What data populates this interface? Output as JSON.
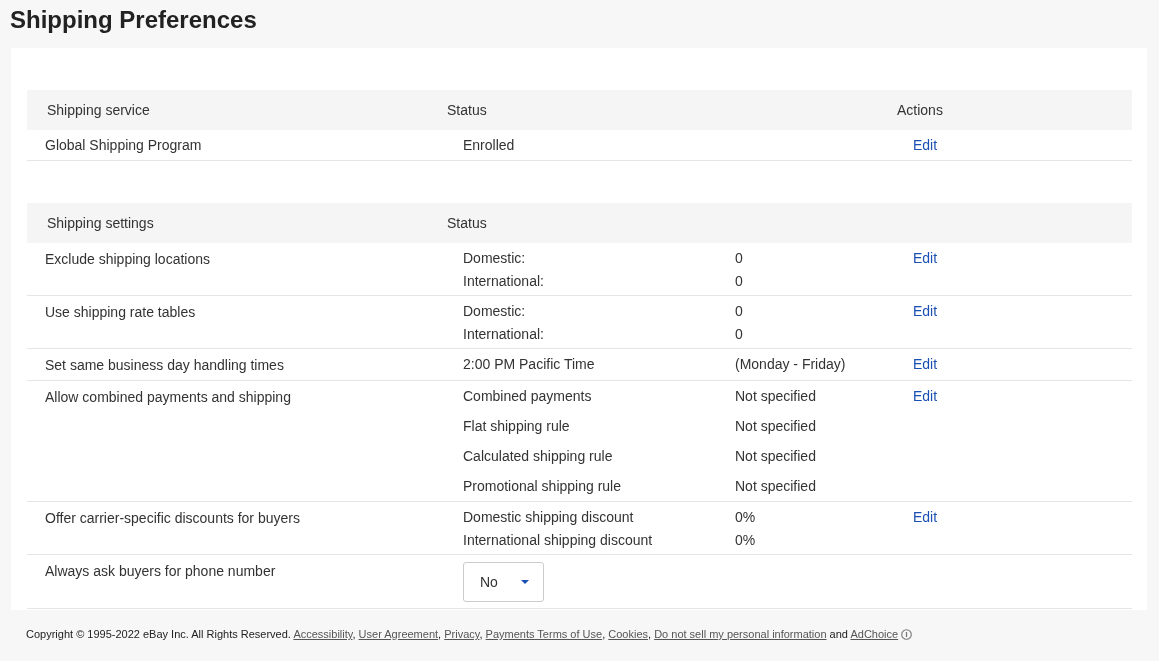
{
  "title": "Shipping Preferences",
  "service_table": {
    "columns": [
      "Shipping service",
      "Status",
      "Actions"
    ],
    "rows": [
      {
        "service": "Global Shipping Program",
        "status": "Enrolled",
        "action": "Edit"
      }
    ]
  },
  "settings_table": {
    "columns": [
      "Shipping settings",
      "Status"
    ],
    "rows": [
      {
        "kind": "pairs",
        "setting": "Exclude shipping locations",
        "details": [
          {
            "label": "Domestic:",
            "value": "0"
          },
          {
            "label": "International:",
            "value": "0"
          }
        ],
        "action": "Edit"
      },
      {
        "kind": "pairs",
        "setting": "Use shipping rate tables",
        "details": [
          {
            "label": "Domestic:",
            "value": "0"
          },
          {
            "label": "International:",
            "value": "0"
          }
        ],
        "action": "Edit"
      },
      {
        "kind": "pairs",
        "setting": "Set same business day handling times",
        "details": [
          {
            "label": "2:00 PM Pacific Time",
            "value": "(Monday - Friday)"
          }
        ],
        "action": "Edit"
      },
      {
        "kind": "list",
        "setting": "Allow combined payments and shipping",
        "details": [
          {
            "label": "Combined payments",
            "value": "Not specified"
          },
          {
            "label": "Flat shipping rule",
            "value": "Not specified"
          },
          {
            "label": "Calculated shipping rule",
            "value": "Not specified"
          },
          {
            "label": "Promotional shipping rule",
            "value": "Not specified"
          }
        ],
        "action": "Edit"
      },
      {
        "kind": "pairs",
        "setting": "Offer carrier-specific discounts for buyers",
        "details": [
          {
            "label": "Domestic shipping discount",
            "value": "0%"
          },
          {
            "label": "International shipping discount",
            "value": "0%"
          }
        ],
        "action": "Edit"
      },
      {
        "kind": "dropdown",
        "setting": "Always ask buyers for phone number",
        "value": "No"
      }
    ]
  },
  "footer": [
    {
      "kind": "text",
      "text": "Copyright © 1995-2022 eBay Inc. All Rights Reserved."
    },
    {
      "kind": "link",
      "text": "Accessibility"
    },
    {
      "kind": "text",
      "text": ","
    },
    {
      "kind": "link",
      "text": "User Agreement"
    },
    {
      "kind": "text",
      "text": ","
    },
    {
      "kind": "link",
      "text": "Privacy"
    },
    {
      "kind": "text",
      "text": ","
    },
    {
      "kind": "link",
      "text": "Payments Terms of Use"
    },
    {
      "kind": "text",
      "text": ","
    },
    {
      "kind": "link",
      "text": "Cookies"
    },
    {
      "kind": "text",
      "text": ","
    },
    {
      "kind": "link",
      "text": "Do not sell my personal information"
    },
    {
      "kind": "text",
      "text": " and"
    },
    {
      "kind": "link",
      "text": "AdChoice"
    }
  ]
}
